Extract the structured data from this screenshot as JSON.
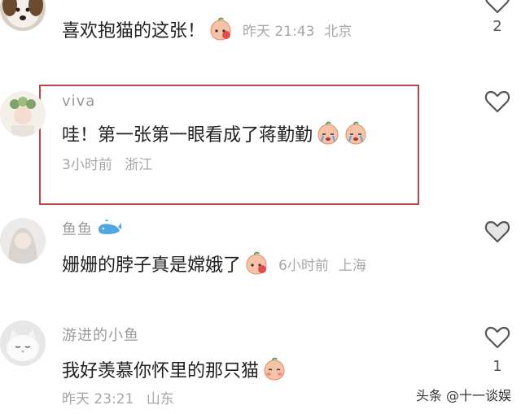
{
  "comments": [
    {
      "text": "喜欢抱猫的这张！",
      "time": "昨天 21:43",
      "location": "北京",
      "like_count": "2",
      "avatar_icon": "dog-avatar-icon",
      "emoji_icon": "peach-emoji-icon"
    },
    {
      "username": "viva",
      "text": "哇！第一张第一眼看成了蒋勤勤",
      "time": "3小时前",
      "location": "浙江",
      "avatar_icon": "flower-girl-avatar-icon",
      "emoji_icon": "crying-peach-emoji-icon"
    },
    {
      "username": "鱼鱼",
      "text": "姗姗的脖子真是嫦娥了",
      "time": "6小时前",
      "location": "上海",
      "avatar_icon": "girl-avatar-icon",
      "emoji_icon": "peach-emoji-icon",
      "badge_icon": "whale-icon"
    },
    {
      "username": " 游进的小鱼",
      "text": "我好羡慕你怀里的那只猫",
      "time": "昨天 23:21",
      "location": "山东",
      "like_count": "1",
      "avatar_icon": "white-kitten-avatar-icon",
      "emoji_icon": "shy-peach-emoji-icon"
    }
  ],
  "watermark": "头条 @十一谈娱",
  "colors": {
    "highlight_border": "#b9464a",
    "meta_text": "#a6a6a6"
  }
}
